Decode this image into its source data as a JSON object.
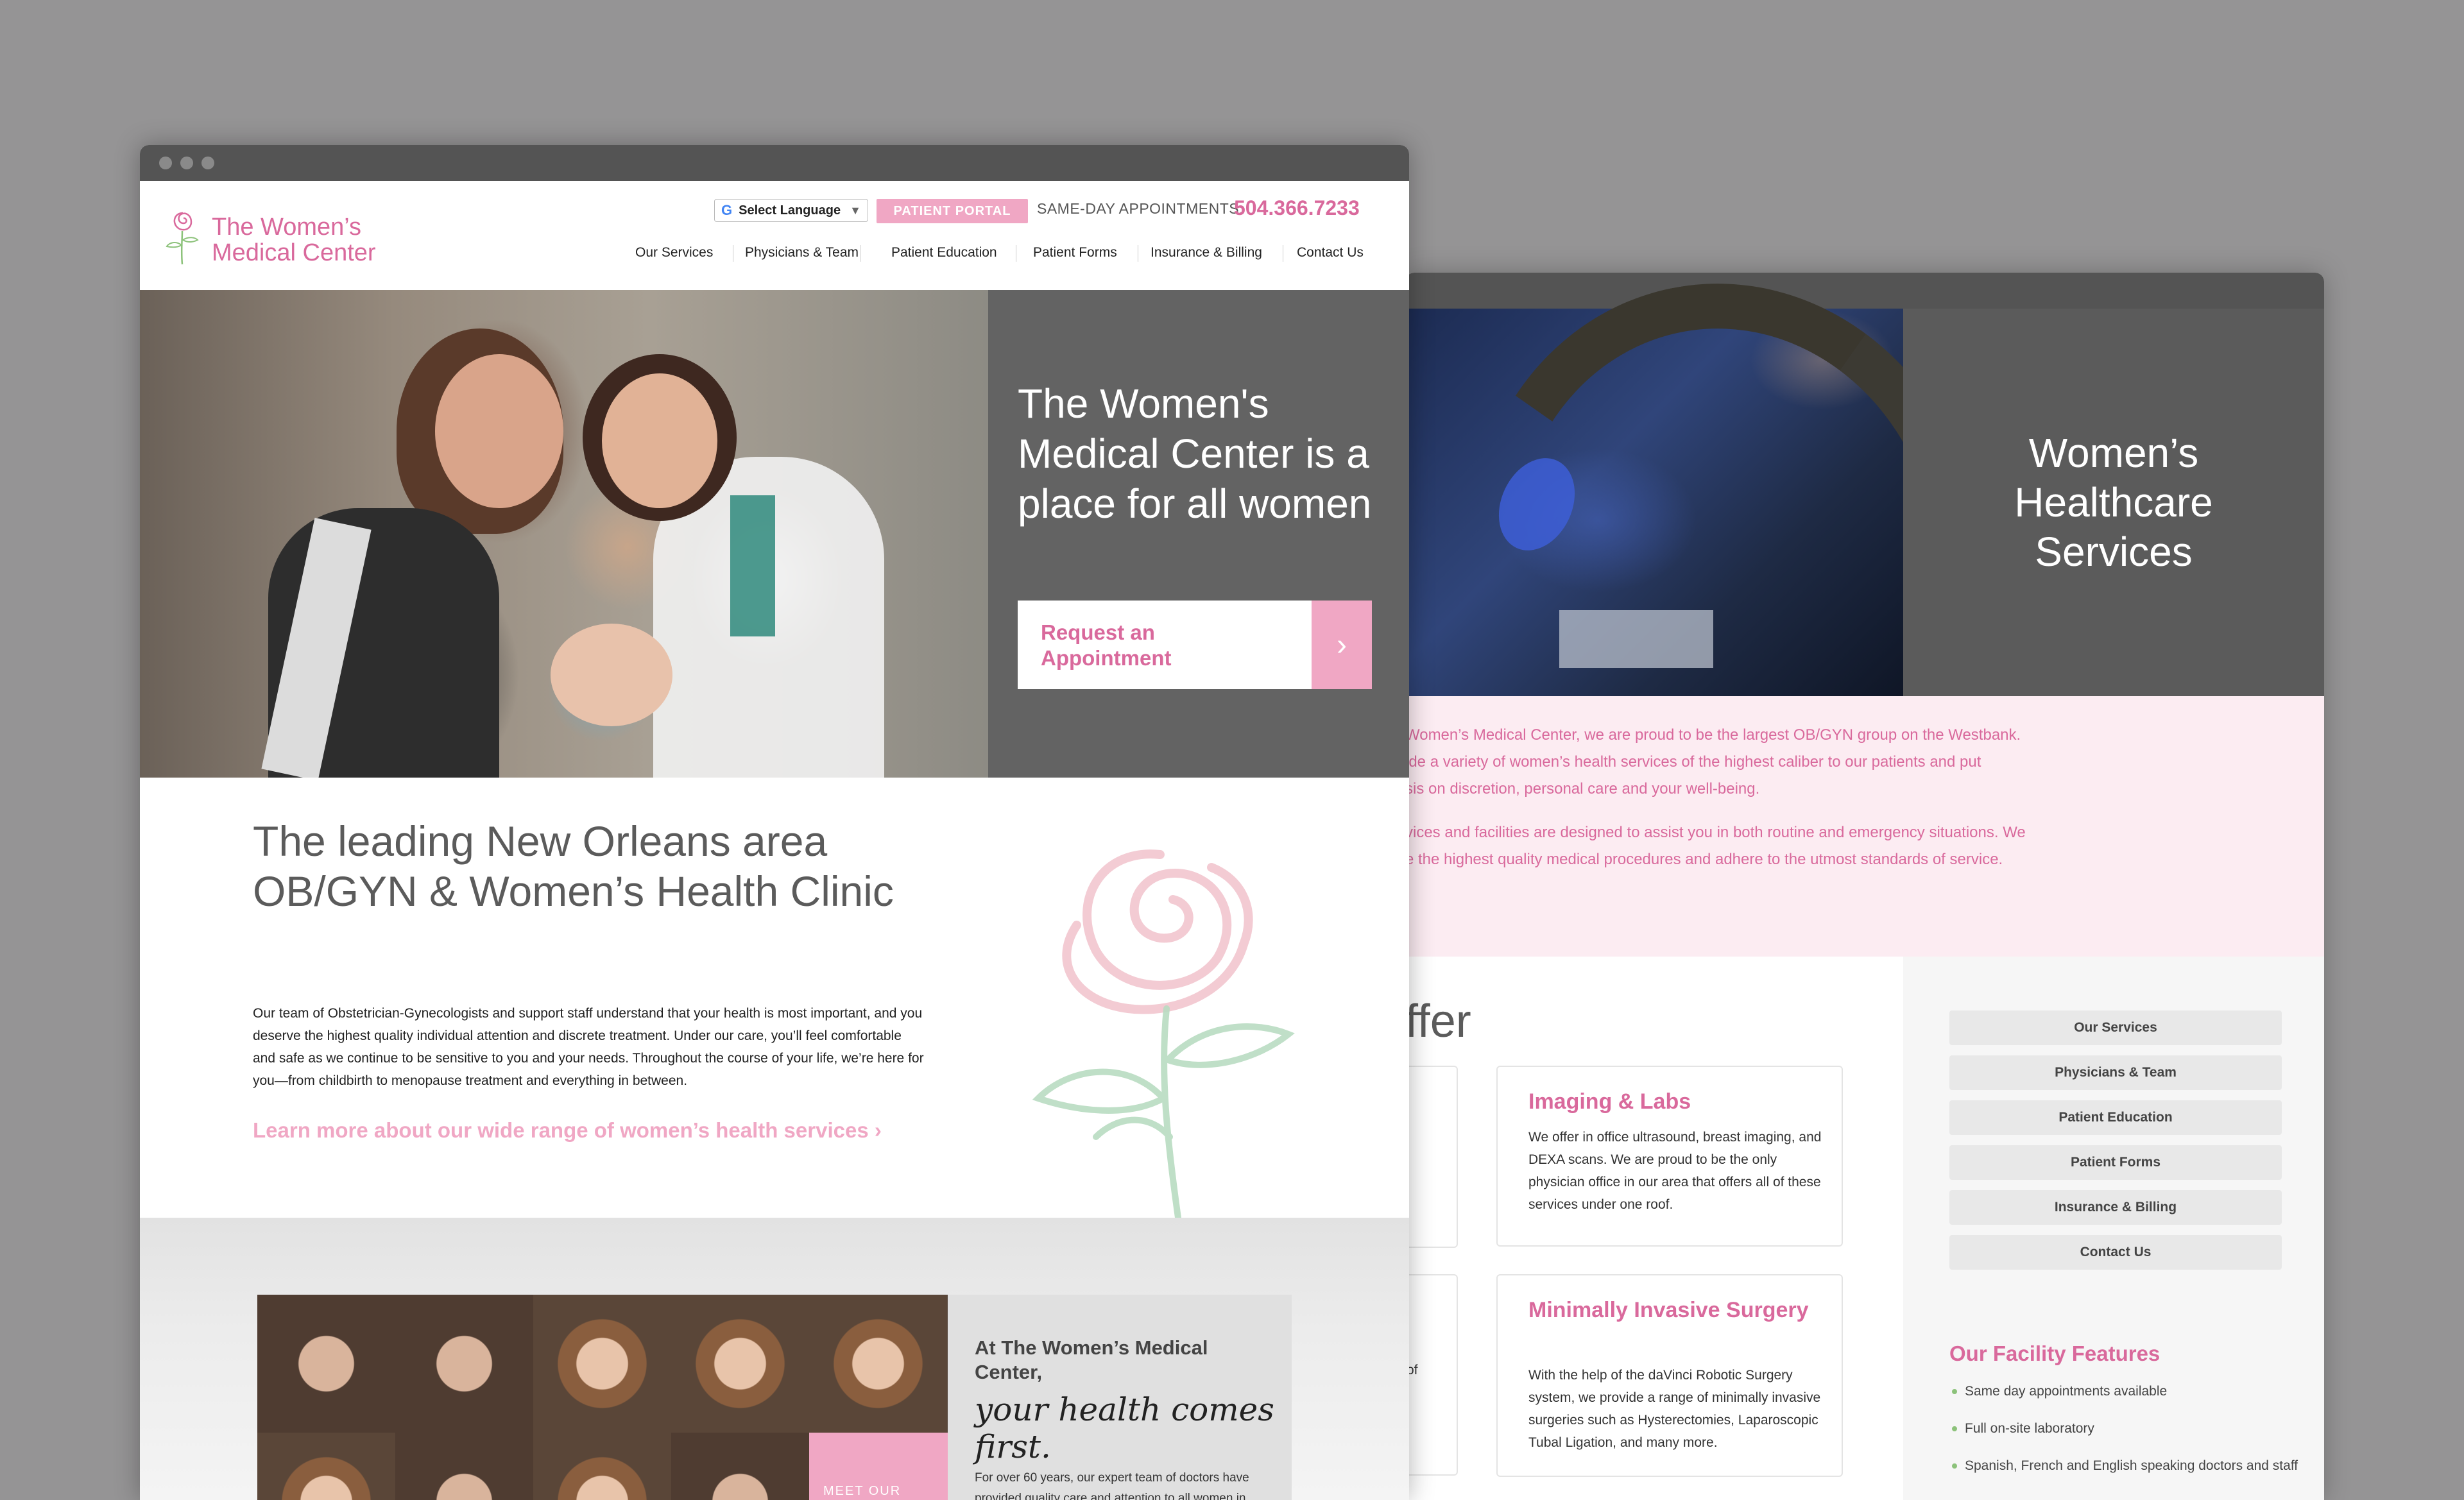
{
  "front": {
    "logo": {
      "line1": "The Women’s",
      "line2": "Medical Center"
    },
    "language_select": {
      "label": "Select Language",
      "google": "G",
      "arrow": "▼"
    },
    "portal_label": "PATIENT PORTAL",
    "sameday_label": "SAME-DAY APPOINTMENTS:",
    "phone": "504.366.7233",
    "nav": [
      "Our Services",
      "Physicians & Team",
      "Patient Education",
      "Patient Forms",
      "Insurance & Billing",
      "Contact Us"
    ],
    "hero": {
      "title": "The Women's Medical Center is a place for all women",
      "cta_line1": "Request an",
      "cta_line2": "Appointment",
      "cta_arrow": "›"
    },
    "intro": {
      "title": "The leading New Orleans area OB/GYN & Women’s Health Clinic",
      "body": "Our team of Obstetrician-Gynecologists and support staff understand that your health is most important, and you deserve the highest quality individual attention and discrete treatment. Under our care, you’ll feel comfortable and safe as we continue to be sensitive to you and your needs. Throughout the course of your life, we’re here for you—from childbirth to menopause treatment and everything in between.",
      "link": "Learn more about our wide range of women’s health services ›"
    },
    "team": {
      "heading": "At The Women’s Medical Center,",
      "tagline": "your health comes first.",
      "body": "For over 60 years, our expert team of doctors have provided quality care and attention to all women in",
      "meet_label": "MEET OUR"
    }
  },
  "back": {
    "hero_title": "Women’s Healthcare Services",
    "intro_lines": [
      "Women’s Medical Center, we are proud to be the largest OB/GYN group on the Westbank.",
      "ide a variety of women’s health services of the highest caliber to our patients and put",
      "sis on discretion, personal care and your well-being.",
      "vices and facilities are designed to assist you in both routine and emergency situations. We",
      "e the highest quality medical procedures and adhere to the utmost standards of service."
    ],
    "offer_title": "ffer",
    "cards": [
      {
        "title": "Imaging & Labs",
        "body": "We offer in office ultrasound, breast imaging, and DEXA scans. We are proud to be the only physician office in our area that offers all of these services under one roof."
      },
      {
        "title": "Minimally Invasive Surgery",
        "body": "With the help of the daVinci Robotic Surgery system, we provide a range of minimally invasive surgeries such as Hysterectomies, Laparoscopic Tubal Ligation, and many more."
      }
    ],
    "partial_card_text": "of",
    "sidebar_buttons": [
      "Our Services",
      "Physicians & Team",
      "Patient Education",
      "Patient Forms",
      "Insurance & Billing",
      "Contact Us"
    ],
    "facility_title": "Our Facility Features",
    "facility_features": [
      "Same day appointments available",
      "Full on-site laboratory",
      "Spanish, French and English speaking doctors and staff"
    ]
  }
}
